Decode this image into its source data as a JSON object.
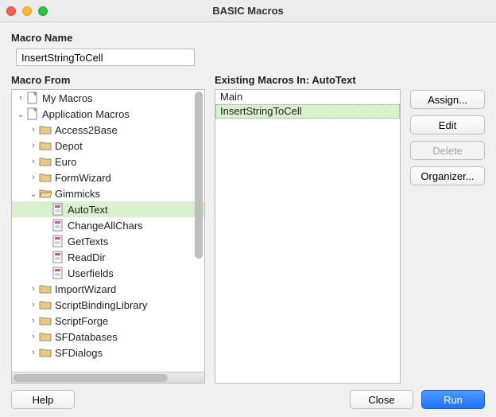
{
  "window": {
    "title": "BASIC Macros"
  },
  "labels": {
    "macro_name": "Macro Name",
    "macro_from": "Macro From",
    "existing_macros_prefix": "Existing Macros In: "
  },
  "macro_name_value": "InsertStringToCell",
  "selected_container": "AutoText",
  "tree": {
    "roots": [
      {
        "label": "My Macros",
        "icon": "doc",
        "expandable": true,
        "expanded": false
      },
      {
        "label": "Application Macros",
        "icon": "doc",
        "expandable": true,
        "expanded": true,
        "children": [
          {
            "label": "Access2Base",
            "icon": "folder",
            "expandable": true
          },
          {
            "label": "Depot",
            "icon": "folder",
            "expandable": true
          },
          {
            "label": "Euro",
            "icon": "folder",
            "expandable": true
          },
          {
            "label": "FormWizard",
            "icon": "folder",
            "expandable": true
          },
          {
            "label": "Gimmicks",
            "icon": "folder-open",
            "expandable": true,
            "expanded": true,
            "children": [
              {
                "label": "AutoText",
                "icon": "module",
                "selected": true
              },
              {
                "label": "ChangeAllChars",
                "icon": "module"
              },
              {
                "label": "GetTexts",
                "icon": "module"
              },
              {
                "label": "ReadDir",
                "icon": "module"
              },
              {
                "label": "Userfields",
                "icon": "module"
              }
            ]
          },
          {
            "label": "ImportWizard",
            "icon": "folder",
            "expandable": true
          },
          {
            "label": "ScriptBindingLibrary",
            "icon": "folder",
            "expandable": true
          },
          {
            "label": "ScriptForge",
            "icon": "folder",
            "expandable": true
          },
          {
            "label": "SFDatabases",
            "icon": "folder",
            "expandable": true
          },
          {
            "label": "SFDialogs",
            "icon": "folder",
            "expandable": true
          }
        ]
      }
    ]
  },
  "existing_macros": [
    {
      "label": "Main",
      "selected": false
    },
    {
      "label": "InsertStringToCell",
      "selected": true
    }
  ],
  "side_buttons": {
    "assign": "Assign...",
    "edit": "Edit",
    "delete": "Delete",
    "organizer": "Organizer..."
  },
  "footer_buttons": {
    "help": "Help",
    "close": "Close",
    "run": "Run"
  }
}
